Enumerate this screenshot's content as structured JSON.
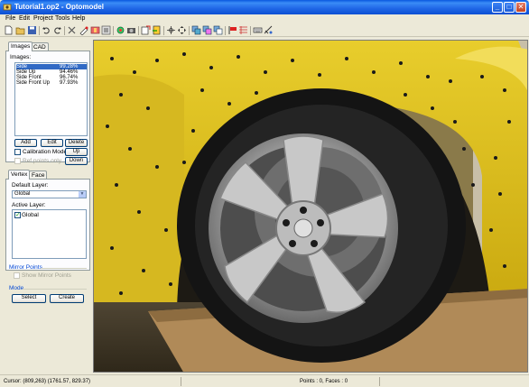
{
  "window": {
    "title": "Tutorial1.op2 - Optomodel",
    "minimize": "_",
    "maximize": "□",
    "close": "✕"
  },
  "menu": {
    "items": [
      "File",
      "Edit",
      "Project",
      "Tools",
      "Help"
    ]
  },
  "toolbar": {
    "icons": [
      "new-icon",
      "open-icon",
      "save-icon",
      "undo-icon",
      "redo-icon",
      "delete-icon",
      "point-tool-icon",
      "mesh-icon",
      "texture-icon",
      "orbit-icon",
      "camera-icon",
      "export-icon",
      "import-icon",
      "select-vertex-icon",
      "move-vertex-icon",
      "copy-icon",
      "paste-icon",
      "group-icon",
      "flag-icon",
      "grid-icon",
      "keyboard-icon",
      "measure-icon"
    ]
  },
  "images_panel": {
    "tabs": [
      "Images",
      "CAD"
    ],
    "active_tab": "Images",
    "list_label": "Images:",
    "images": [
      {
        "name": "Side",
        "quality": "99.28%",
        "selected": true
      },
      {
        "name": "Side Up",
        "quality": "94.46%",
        "selected": false
      },
      {
        "name": "Side Front",
        "quality": "96.74%",
        "selected": false
      },
      {
        "name": "Side Front Up",
        "quality": "97.93%",
        "selected": false
      }
    ],
    "add_label": "Add",
    "edit_label": "Edit",
    "delete_label": "Delete",
    "calibration_label": "Calibration Mode",
    "calibration_checked": false,
    "up_label": "Up",
    "ref_points_label": "Ref points only",
    "down_label": "Down"
  },
  "vertex_panel": {
    "tabs": [
      "Vertex",
      "Face"
    ],
    "active_tab": "Vertex",
    "default_layer_label": "Default Layer:",
    "default_layer_value": "Global",
    "active_layer_label": "Active Layer:",
    "layers": [
      {
        "name": "Global",
        "checked": true
      }
    ]
  },
  "mirror": {
    "group_label": "Mirror Points",
    "show_label": "Show Mirror Points"
  },
  "mode": {
    "group_label": "Mode",
    "select_label": "Select",
    "create_label": "Create"
  },
  "status": {
    "cursor": "Cursor: (809,263) (1761.57, 829.37)",
    "counts": "Points : 0, Faces : 0"
  },
  "colors": {
    "car_body": "#e8c41a",
    "tire": "#1a1a1a",
    "rim": "#b8b8b8",
    "titlebar": "#0a58e0"
  }
}
